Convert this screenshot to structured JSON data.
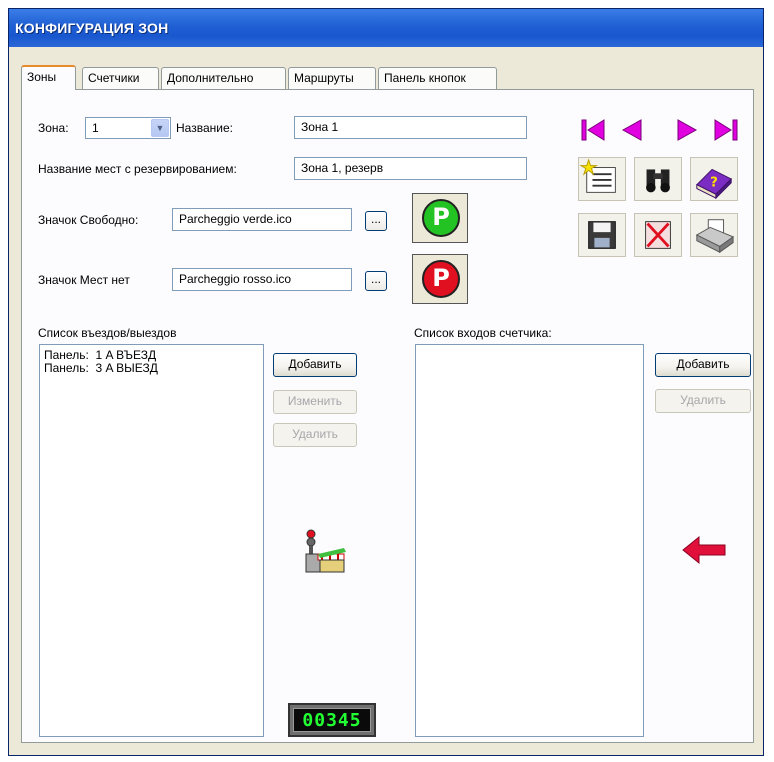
{
  "window": {
    "title": "КОНФИГУРАЦИЯ ЗОН"
  },
  "tabs": [
    {
      "label": "Зоны"
    },
    {
      "label": "Счетчики"
    },
    {
      "label": "Дополнительно"
    },
    {
      "label": "Маршруты"
    },
    {
      "label": "Панель кнопок"
    }
  ],
  "zone": {
    "zone_label": "Зона:",
    "zone_value": "1",
    "name_label": "Название:",
    "name_value": "Зона 1",
    "reserved_label": "Название мест с резервированием:",
    "reserved_value": "Зона 1, резерв",
    "free_icon_label": "Значок Свободно:",
    "free_icon_value": "Parcheggio verde.ico",
    "full_icon_label": "Значок Мест нет",
    "full_icon_value": "Parcheggio rosso.ico",
    "browse_label": "...",
    "parking_letter": "P"
  },
  "entries": {
    "label": "Список въездов/выездов",
    "items": [
      "Панель:  1 A ВЪЕЗД",
      "Панель:  3 A ВЫЕЗД"
    ],
    "add": "Добавить",
    "edit": "Изменить",
    "delete": "Удалить"
  },
  "counter_inputs": {
    "label": "Список входов счетчика:",
    "items": [],
    "add": "Добавить",
    "delete": "Удалить"
  },
  "counter_display": "00345",
  "icons": {
    "nav": [
      "first-record-icon",
      "previous-record-icon",
      "next-record-icon",
      "last-record-icon"
    ],
    "tools": [
      "new-record-icon",
      "search-binoculars-icon",
      "help-book-icon",
      "save-floppy-icon",
      "delete-record-icon",
      "print-icon"
    ]
  },
  "colors": {
    "titlebar": "#245edb",
    "nav_arrow": "#e000e0",
    "free_icon": "#22c322",
    "full_icon": "#e01020",
    "red_arrow": "#e0103a",
    "counter_digits": "#22ff33"
  }
}
